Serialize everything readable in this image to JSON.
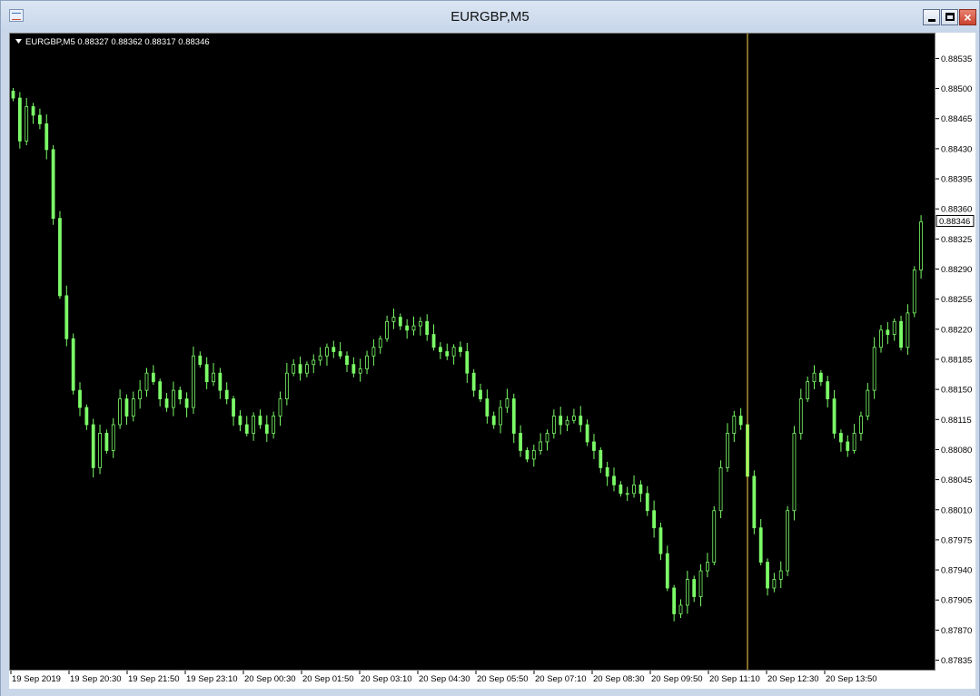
{
  "window": {
    "title": "EURGBP,M5"
  },
  "chart": {
    "info_line": "EURGBP,M5  0.88327 0.88362 0.88317 0.88346",
    "current_price_label": "0.88346",
    "crosshair_time_index": 110,
    "colors": {
      "background": "#000000",
      "bull": "#7CFC68",
      "bear": "#7CFC68",
      "crosshair": "#FFD84A"
    }
  },
  "chart_data": {
    "type": "candlestick",
    "symbol": "EURGBP",
    "timeframe": "M5",
    "ylim": [
      0.87825,
      0.88565
    ],
    "price_ticks": [
      "0.88535",
      "0.88500",
      "0.88465",
      "0.88430",
      "0.88395",
      "0.88360",
      "0.88325",
      "0.88290",
      "0.88255",
      "0.88220",
      "0.88185",
      "0.88150",
      "0.88115",
      "0.88080",
      "0.88045",
      "0.88010",
      "0.87975",
      "0.87940",
      "0.87905",
      "0.87870",
      "0.87835"
    ],
    "time_ticks": [
      "19 Sep 2019",
      "19 Sep 20:30",
      "19 Sep 21:50",
      "19 Sep 23:10",
      "20 Sep 00:30",
      "20 Sep 01:50",
      "20 Sep 03:10",
      "20 Sep 04:30",
      "20 Sep 05:50",
      "20 Sep 07:10",
      "20 Sep 08:30",
      "20 Sep 09:50",
      "20 Sep 11:10",
      "20 Sep 12:30",
      "20 Sep 13:50"
    ],
    "close": [
      0.8849,
      0.8844,
      0.8848,
      0.8847,
      0.8846,
      0.8843,
      0.8835,
      0.8826,
      0.8821,
      0.8815,
      0.8813,
      0.8811,
      0.8806,
      0.881,
      0.8808,
      0.8811,
      0.8814,
      0.8812,
      0.8814,
      0.8815,
      0.8817,
      0.8816,
      0.8814,
      0.8813,
      0.8815,
      0.8814,
      0.8813,
      0.8819,
      0.8818,
      0.8816,
      0.8817,
      0.8815,
      0.8814,
      0.8812,
      0.8811,
      0.881,
      0.8812,
      0.8811,
      0.881,
      0.8812,
      0.8814,
      0.8817,
      0.8818,
      0.8817,
      0.8818,
      0.88185,
      0.8819,
      0.882,
      0.88195,
      0.8819,
      0.8818,
      0.8817,
      0.88175,
      0.8819,
      0.882,
      0.8821,
      0.8823,
      0.88235,
      0.88225,
      0.8822,
      0.88225,
      0.8823,
      0.88215,
      0.882,
      0.88195,
      0.8819,
      0.882,
      0.88195,
      0.8817,
      0.8815,
      0.8814,
      0.8812,
      0.8811,
      0.8813,
      0.8814,
      0.881,
      0.8808,
      0.8807,
      0.8808,
      0.8809,
      0.881,
      0.8812,
      0.8811,
      0.88115,
      0.8812,
      0.8811,
      0.8809,
      0.8808,
      0.8806,
      0.8805,
      0.8804,
      0.8803,
      0.8803,
      0.8804,
      0.8803,
      0.8801,
      0.8799,
      0.8796,
      0.8792,
      0.8789,
      0.879,
      0.8793,
      0.8791,
      0.8794,
      0.8795,
      0.8801,
      0.8806,
      0.881,
      0.8812,
      0.8811,
      0.8805,
      0.8799,
      0.8795,
      0.8792,
      0.8793,
      0.8794,
      0.8801,
      0.881,
      0.8814,
      0.8816,
      0.8817,
      0.8816,
      0.8814,
      0.881,
      0.8809,
      0.8808,
      0.881,
      0.8812,
      0.8815,
      0.882,
      0.8822,
      0.88215,
      0.8823,
      0.882,
      0.8824,
      0.8829,
      0.88346
    ],
    "volatility": 9e-05
  }
}
